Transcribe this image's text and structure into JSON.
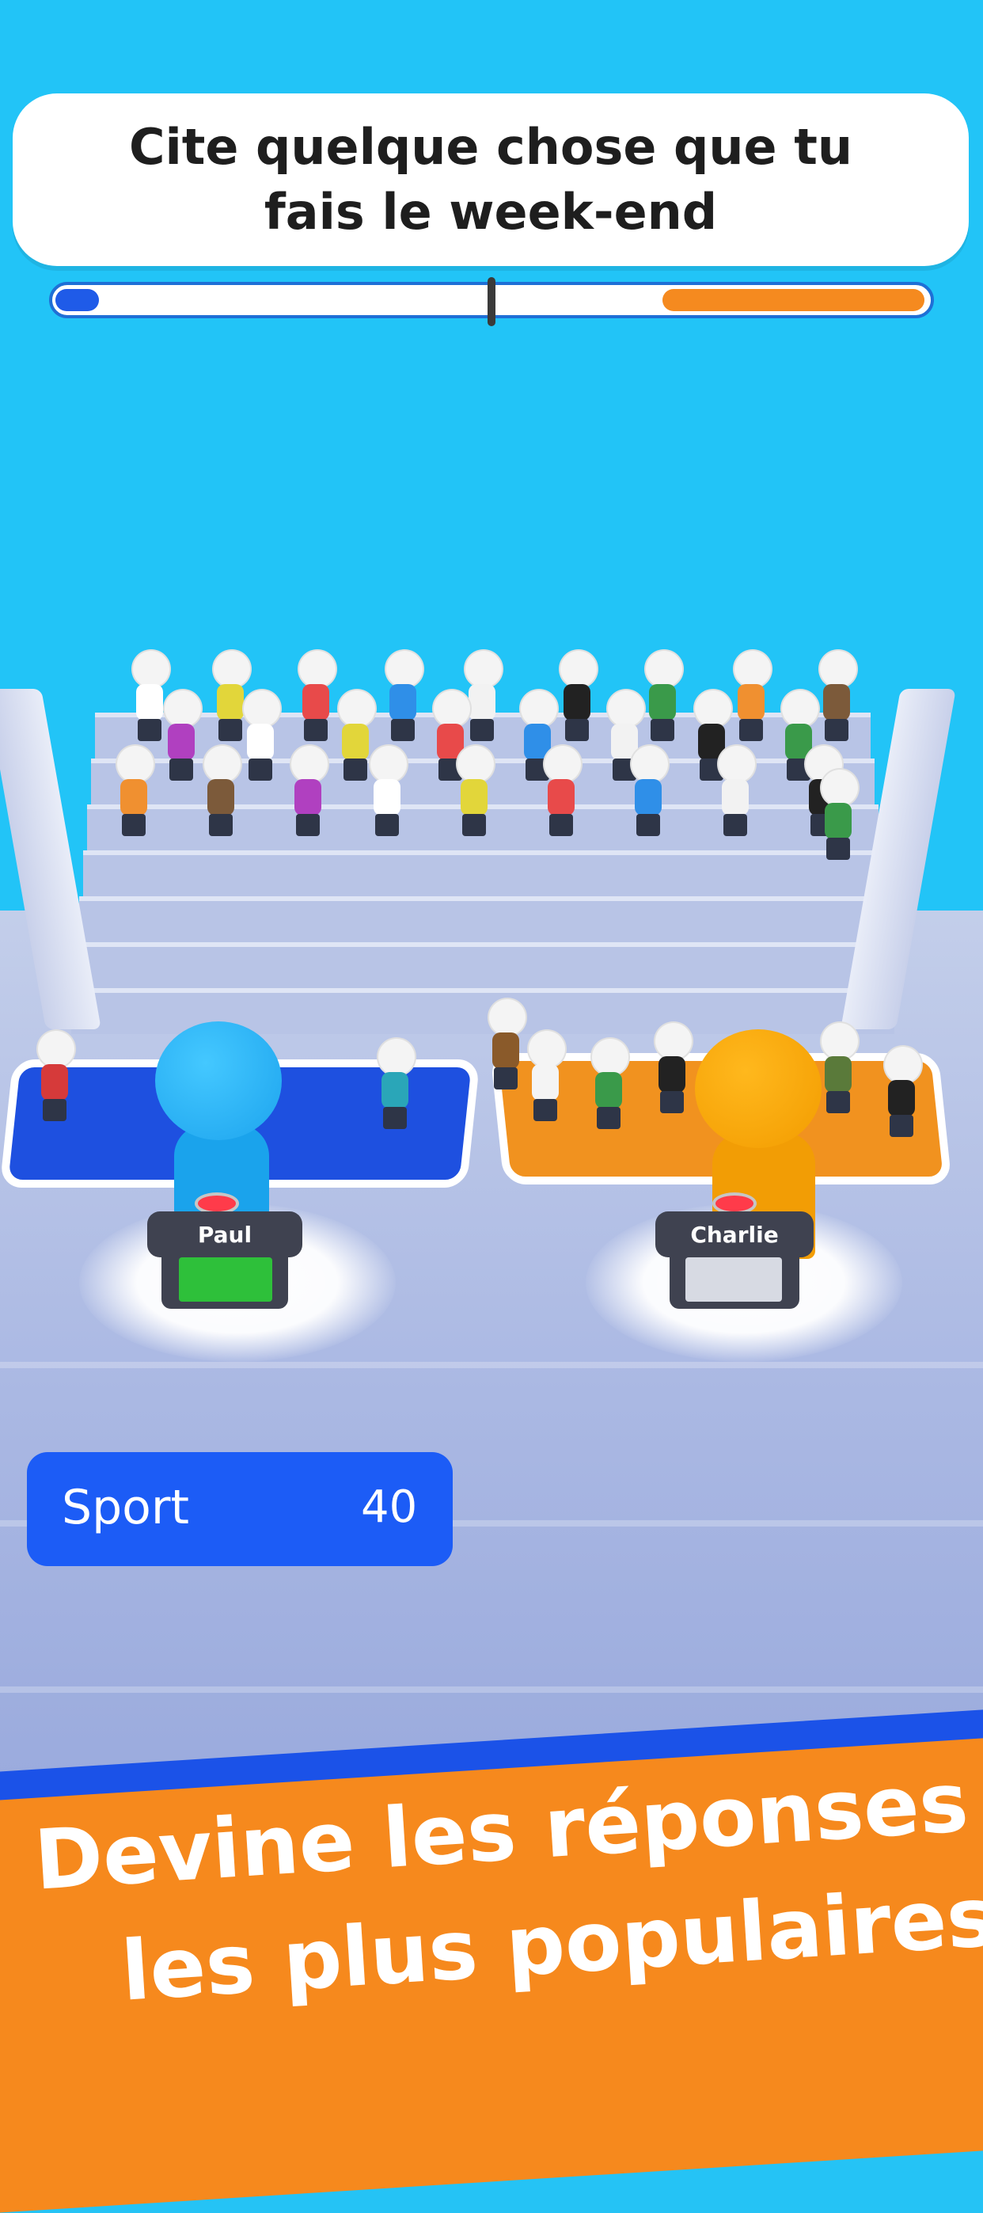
{
  "question": {
    "text": "Cite quelque chose que tu fais le week-end"
  },
  "progress": {
    "left_fraction": 0.05,
    "right_fraction": 0.3,
    "left_color": "#1f5be8",
    "right_color": "#f58a1f"
  },
  "players": {
    "left": {
      "name": "Paul",
      "color": "#1da4ee",
      "screen_color": "#2ec03a"
    },
    "right": {
      "name": "Charlie",
      "color": "#f39c00",
      "screen_color": "#d7dae3"
    }
  },
  "answer": {
    "label": "Sport",
    "points": "40"
  },
  "banner": {
    "line1": "Devine les réponses",
    "line2": "les plus populaires"
  },
  "colors": {
    "sky": "#22c4f7",
    "team_left": "#1e50e0",
    "team_right": "#f1921f",
    "banner": "#f6891d"
  }
}
